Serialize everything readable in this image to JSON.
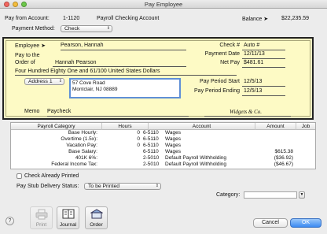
{
  "window": {
    "title": "Pay Employee"
  },
  "header": {
    "pay_from_label": "Pay from Account:",
    "account_number": "1-1120",
    "account_name": "Payroll Checking Account",
    "balance_label": "Balance",
    "balance_value": "$22,235.59",
    "payment_method_label": "Payment Method:",
    "payment_method_value": "Check"
  },
  "check": {
    "employee_label": "Employee",
    "employee_value": "Pearson, Hannah",
    "check_no_label": "Check #",
    "check_no_value": "Auto #",
    "pay_to_label_1": "Pay to the",
    "pay_to_label_2": "Order of",
    "payee": "Hannah Pearson",
    "payment_date_label": "Payment Date",
    "payment_date_value": "12/11/13",
    "net_pay_label": "Net Pay",
    "net_pay_value": "$481.61",
    "amount_words": "Four Hundred Eighty One and 61/100 United States Dollars",
    "address_selector": "Address 1",
    "address_line1": "57 Cove Road",
    "address_line2": "Montclair, NJ 08889",
    "pay_period_start_label": "Pay Period Start",
    "pay_period_start_value": "12/5/13",
    "pay_period_end_label": "Pay Period Ending",
    "pay_period_end_value": "12/5/13",
    "memo_label": "Memo",
    "memo_value": "Paycheck",
    "signature": "Widgets & Co."
  },
  "table": {
    "columns": [
      "Payroll Category",
      "Hours",
      "Account",
      "Amount",
      "Job"
    ],
    "rows": [
      {
        "category": "Base Hourly:",
        "hours": "0",
        "account": "6-5110",
        "account_name": "Wages",
        "amount": ""
      },
      {
        "category": "Overtime (1.5x):",
        "hours": "0",
        "account": "6-5110",
        "account_name": "Wages",
        "amount": ""
      },
      {
        "category": "Vacation Pay:",
        "hours": "0",
        "account": "6-5110",
        "account_name": "Wages",
        "amount": ""
      },
      {
        "category": "Base Salary:",
        "hours": "",
        "account": "6-5110",
        "account_name": "Wages",
        "amount": "$615.38"
      },
      {
        "category": "401K 6%:",
        "hours": "",
        "account": "2-5010",
        "account_name": "Default Payroll Withholding",
        "amount": "($36.92)"
      },
      {
        "category": "Federal Income Tax:",
        "hours": "",
        "account": "2-5010",
        "account_name": "Default Payroll Withholding",
        "amount": "($46.67)"
      }
    ]
  },
  "options": {
    "check_already_printed_label": "Check Already Printed",
    "check_already_printed": false,
    "stub_delivery_label": "Pay Stub Delivery Status:",
    "stub_delivery_value": "To be Printed",
    "category_label": "Category:",
    "category_value": ""
  },
  "footer": {
    "help_label": "?",
    "print_label": "Print",
    "journal_label": "Journal",
    "order_label": "Order",
    "cancel_label": "Cancel",
    "ok_label": "OK"
  },
  "colors": {
    "check_background": "#fdfac5",
    "primary_button": "#3b8af2",
    "address_focus": "#5f8fd6"
  }
}
